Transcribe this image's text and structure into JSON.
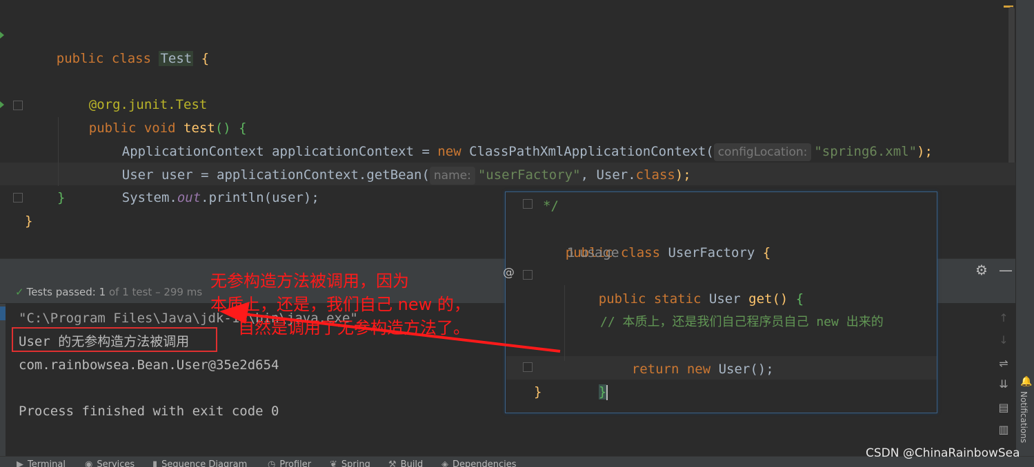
{
  "editor": {
    "lines": {
      "class_decl": {
        "kw": "public class ",
        "name": "Test",
        "brace": " {"
      },
      "annotation": "@org.junit.Test",
      "method_decl": {
        "kw": "public void ",
        "name": "test",
        "rest": "() {"
      },
      "line_ctx": {
        "type": "ApplicationContext applicationContext = ",
        "kw_new": "new",
        "ctor": " ClassPathXmlApplicationContext(",
        "hint": "configLocation:",
        "arg": "\"spring6.xml\"",
        "end": ");"
      },
      "line_user": {
        "code": "User user = applicationContext.getBean(",
        "hint": "name:",
        "arg": "\"userFactory\"",
        "mid": ", User.",
        "kw_class": "class",
        "end": ");"
      },
      "line_print": {
        "pre": "System.",
        "field": "out",
        "post": ".println(user);"
      },
      "close_method": "}",
      "close_class": "}"
    }
  },
  "run_panel": {
    "tests_passed": {
      "label": "Tests passed:",
      "count": "1",
      "rest": "of 1 test – 299 ms"
    },
    "console": {
      "java_path": "\"C:\\Program Files\\Java\\jdk-17\\bin\\java.exe\"",
      "line1": "User 的无参构造方法被调用",
      "line2": "com.rainbowsea.Bean.User@35e2d654",
      "line3": "Process finished with exit code 0"
    },
    "icons": [
      "gear-icon",
      "minimize-icon",
      "up-arrow-icon",
      "down-arrow-icon",
      "soft-wrap-icon",
      "scroll-to-end-icon",
      "print-icon",
      "trash-icon"
    ]
  },
  "popup": {
    "comment_end": "*/",
    "class_decl": {
      "kw": "public class ",
      "name": "UserFactory",
      "brace": " {"
    },
    "usage": "1 usage",
    "method_decl": {
      "kw": "public static ",
      "type": "User ",
      "name": "get",
      "rest": "() ",
      "brace": "{"
    },
    "comment": "// 本质上，还是我们自己程序员自己 new 出来的",
    "return_line": {
      "kw_return": "return ",
      "kw_new": "new",
      "rest": " User();"
    },
    "close_method": "}",
    "close_class": "}"
  },
  "annotation": {
    "line1": "无参构造方法被调用，因为",
    "line2": "本质上，还是，我们自己 new 的，",
    "line3": "自然是调用了无参构造方法了。"
  },
  "bottom_bar": {
    "items": [
      "Terminal",
      "Services",
      "Sequence Diagram",
      "Profiler",
      "Spring",
      "Build",
      "Dependencies"
    ]
  },
  "side": {
    "notifications": "Notifications"
  },
  "watermark": "CSDN @ChinaRainbowSea",
  "colors": {
    "keyword": "#cc7832",
    "string": "#6a8759",
    "method": "#ffc66d",
    "annotation_red": "#ff1a1a",
    "passed_green": "#4e9a4e"
  }
}
